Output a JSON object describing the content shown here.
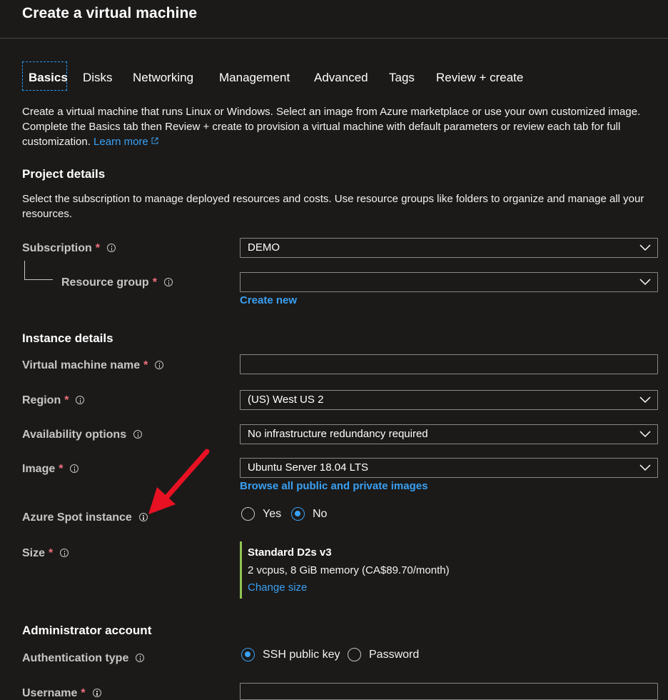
{
  "header": {
    "title": "Create a virtual machine"
  },
  "tabs": [
    {
      "label": "Basics",
      "active": true
    },
    {
      "label": "Disks"
    },
    {
      "label": "Networking"
    },
    {
      "label": "Management"
    },
    {
      "label": "Advanced"
    },
    {
      "label": "Tags"
    },
    {
      "label": "Review + create"
    }
  ],
  "intro": {
    "text": "Create a virtual machine that runs Linux or Windows. Select an image from Azure marketplace or use your own customized image. Complete the Basics tab then Review + create to provision a virtual machine with default parameters or review each tab for full customization. ",
    "learn_more": "Learn more"
  },
  "project_details": {
    "heading": "Project details",
    "description": "Select the subscription to manage deployed resources and costs. Use resource groups like folders to organize and manage all your resources.",
    "subscription": {
      "label": "Subscription",
      "required": "*",
      "value": "DEMO"
    },
    "resource_group": {
      "label": "Resource group",
      "required": "*",
      "value": "",
      "create_new": "Create new"
    }
  },
  "instance_details": {
    "heading": "Instance details",
    "vm_name": {
      "label": "Virtual machine name",
      "required": "*",
      "value": ""
    },
    "region": {
      "label": "Region",
      "required": "*",
      "value": "(US) West US 2"
    },
    "availability": {
      "label": "Availability options",
      "value": "No infrastructure redundancy required"
    },
    "image": {
      "label": "Image",
      "required": "*",
      "value": "Ubuntu Server 18.04 LTS",
      "browse_link": "Browse all public and private images"
    },
    "spot": {
      "label": "Azure Spot instance",
      "options": [
        "Yes",
        "No"
      ],
      "selected": "No"
    },
    "size": {
      "label": "Size",
      "required": "*",
      "name": "Standard D2s v3",
      "description": "2 vcpus, 8 GiB memory (CA$89.70/month)",
      "change_link": "Change size"
    }
  },
  "admin_account": {
    "heading": "Administrator account",
    "auth_type": {
      "label": "Authentication type",
      "options": [
        "SSH public key",
        "Password"
      ],
      "selected": "SSH public key"
    },
    "username": {
      "label": "Username",
      "required": "*",
      "value": ""
    }
  },
  "colors": {
    "background": "#1b1a19",
    "link": "#3aa0f3",
    "required": "#f1707b",
    "size_accent": "#92c353",
    "annotation_arrow": "#e81123"
  }
}
